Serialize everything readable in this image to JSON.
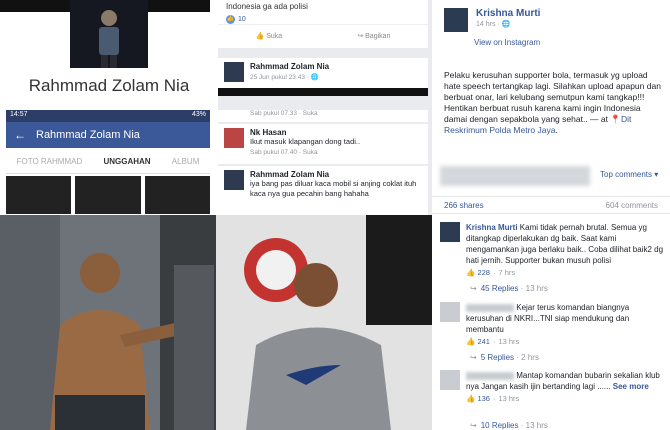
{
  "left": {
    "profile_name": "Rahmmad Zolam Nia",
    "phone_status": {
      "time": "14:57",
      "battery": "43%"
    },
    "phone_header_title": "Rahmmad Zolam Nia",
    "tabs": [
      "FOTO RAHMMAD",
      "UNGGAHAN",
      "ALBUM"
    ],
    "active_tab": "UNGGAHAN"
  },
  "middle": {
    "caption_text": "Indonesia ga ada polisi",
    "like_count": "10",
    "like_action": "Suka",
    "share_action": "Bagikan",
    "post_author": "Rahmmad Zolam Nia",
    "post_date": "25 Jun pukul 23.43 · ",
    "reply_meta": "Sab pukul 07.33 · Suka",
    "comments": [
      {
        "author": "Nk Hasan",
        "text": "Ikut masuk klapangan dong tadi..",
        "meta": "Sab pukul 07.40 · Suka"
      },
      {
        "author": "Rahmmad Zolam Nia",
        "text": "iya bang pas diluar kaca mobil si anjing coklat ituh kaca nya gua pecahin bang hahaha",
        "meta": ""
      }
    ]
  },
  "right": {
    "author": "Krishna Murti",
    "time": "14 hrs · ",
    "view_on": "View on Instagram",
    "caption": "Pelaku kerusuhan supporter bola, termasuk yg upload hate speech tertangkap lagi. Silahkan upload apapun dan berbuat onar, lari kelubang semutpun kami tangkap!!! Hentikan berbuat rusuh karena kami ingin Indonesia damai dengan sepakbola yang sehat.. — at ",
    "location": "Dit Reskrimum Polda Metro Jaya",
    "top_comments": "Top comments ▾",
    "shares": "266 shares",
    "comments_count": "604 comments",
    "comment_list": [
      {
        "author": "Krishna Murti",
        "text": "Kami tidak pernah brutal. Semua yg ditangkap diperlakukan dg baik. Saat kami mengamankan juga berlaku baik.. Coba dilihat baik2 dg hati jernih. Supporter bukan musuh polisi",
        "likes": "228",
        "time": "7 hrs",
        "replies": "45 Replies",
        "replies_time": "13 hrs"
      },
      {
        "author": "",
        "text": "Kejar terus komandan biangnya kerusuhan di NKRI...TNI siap mendukung dan membantu",
        "likes": "241",
        "time": "13 hrs",
        "replies": "5 Replies",
        "replies_time": "2 hrs"
      },
      {
        "author": "",
        "text": "Mantap komandan bubarin sekalian klub nya Jangan kasih ijin bertanding lagi ...... ",
        "see_more": "See more",
        "likes": "136",
        "time": "13 hrs",
        "replies": "10 Replies",
        "replies_time": "13 hrs"
      }
    ]
  },
  "colors": {
    "fb_blue": "#3b5998",
    "link": "#365899",
    "meta_gray": "#90949c"
  }
}
